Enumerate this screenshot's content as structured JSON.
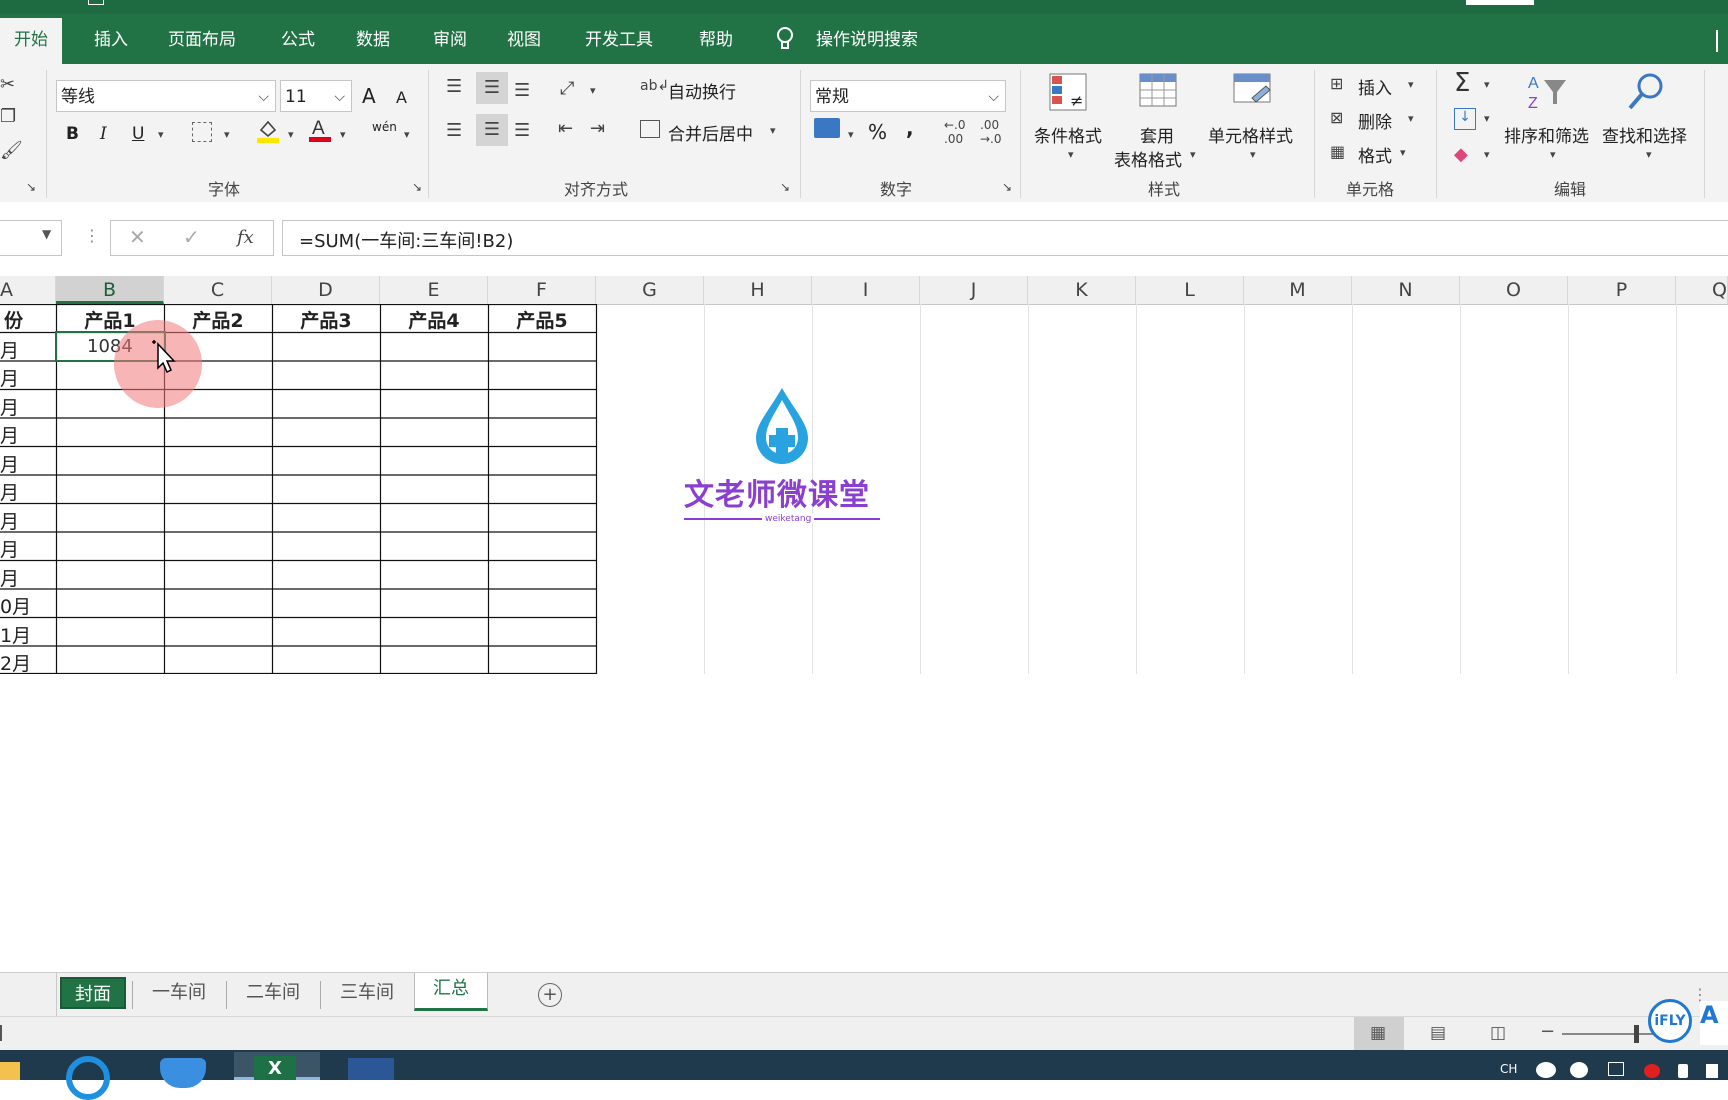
{
  "ribbon_tabs": [
    "开始",
    "插入",
    "页面布局",
    "公式",
    "数据",
    "审阅",
    "视图",
    "开发工具",
    "帮助"
  ],
  "tell_me": "操作说明搜索",
  "font": {
    "name": "等线",
    "size": "11",
    "group_label": "字体",
    "bold": "B",
    "italic": "I",
    "underline": "U",
    "grow": "A",
    "shrink": "A",
    "phonetic": "wén"
  },
  "alignment": {
    "group_label": "对齐方式",
    "wrap_text": "自动换行",
    "merge_center": "合并后居中"
  },
  "number": {
    "group_label": "数字",
    "format": "常规",
    "percent": "%",
    "comma": ","
  },
  "styles": {
    "group_label": "样式",
    "conditional": "条件格式",
    "format_table_1": "套用",
    "format_table_2": "表格格式",
    "cell_styles": "单元格样式"
  },
  "cells": {
    "group_label": "单元格",
    "insert": "插入",
    "delete": "删除",
    "format": "格式"
  },
  "editing": {
    "group_label": "编辑",
    "sort_filter": "排序和筛选",
    "find_select": "查找和选择"
  },
  "formula_bar": {
    "formula": "=SUM(一车间:三车间!B2)",
    "fx": "fx"
  },
  "columns": [
    "A",
    "B",
    "C",
    "D",
    "E",
    "F",
    "G",
    "H",
    "I",
    "J",
    "K",
    "L",
    "M",
    "N",
    "O",
    "P",
    "Q"
  ],
  "table": {
    "header": [
      "份",
      "产品1",
      "产品2",
      "产品3",
      "产品4",
      "产品5"
    ],
    "row_labels": [
      "月",
      "月",
      "月",
      "月",
      "月",
      "月",
      "月",
      "月",
      "月",
      "0月",
      "1月",
      "2月"
    ],
    "b2_value": "1084"
  },
  "watermark": {
    "title": "文老师微课堂",
    "sub": "weiketang"
  },
  "sheet_tabs": [
    "封面",
    "一车间",
    "二车间",
    "三车间",
    "汇总"
  ],
  "active_sheet": "汇总",
  "colors": {
    "excel_green": "#217346",
    "cover_tab": "#217346",
    "purple": "#8a3fd1",
    "drop": "#29a3e0"
  },
  "ifly_badge": "iFLY"
}
